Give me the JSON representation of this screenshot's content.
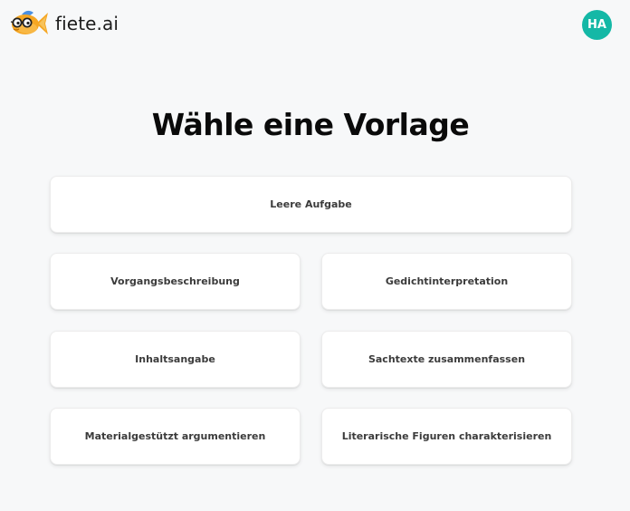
{
  "header": {
    "brand_name": "fiete.ai",
    "logo_icon": "fish-with-glasses-logo",
    "avatar_initials": "HA",
    "avatar_color": "#14b8a6"
  },
  "main": {
    "title": "Wähle eine Vorlage",
    "templates": [
      {
        "label": "Leere Aufgabe"
      },
      {
        "label": "Vorgangsbeschreibung"
      },
      {
        "label": "Gedichtinterpretation"
      },
      {
        "label": "Inhaltsangabe"
      },
      {
        "label": "Sachtexte zusammenfassen"
      },
      {
        "label": "Materialgestützt argumentieren"
      },
      {
        "label": "Literarische Figuren charakterisieren"
      }
    ]
  },
  "colors": {
    "background": "#f7f8f9",
    "card": "#ffffff",
    "logo_orange": "#f5a623",
    "logo_blue": "#4a90e2"
  }
}
